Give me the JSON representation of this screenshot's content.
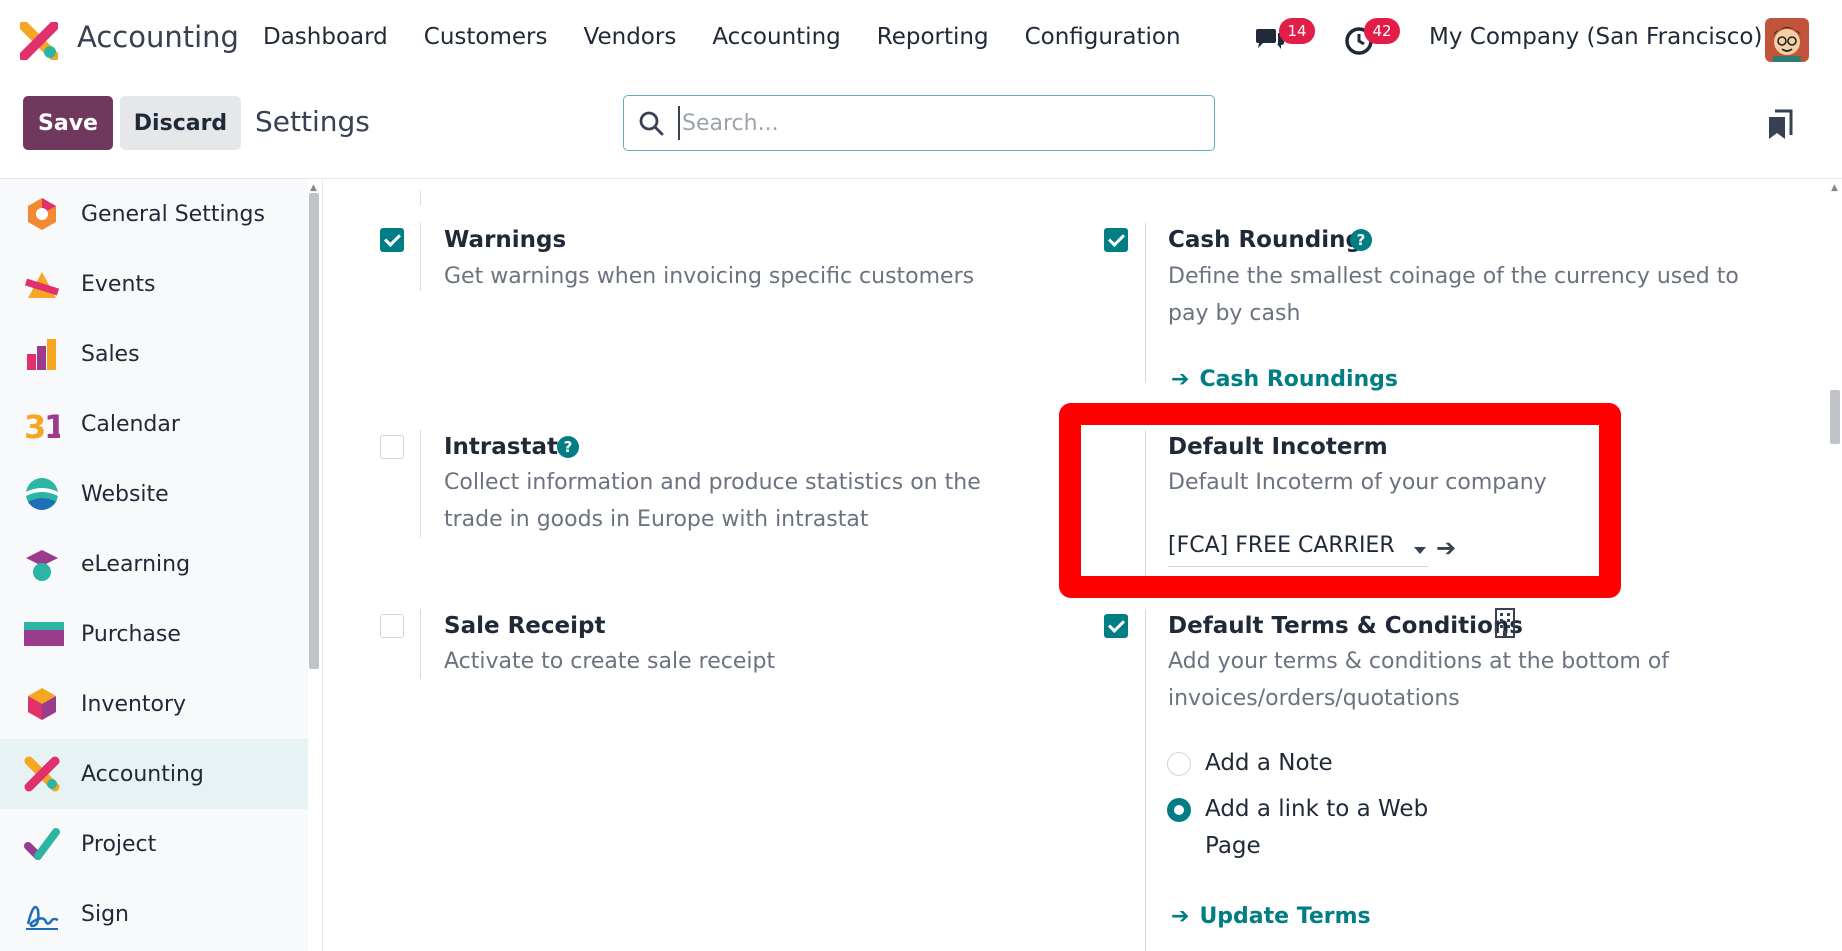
{
  "navbar": {
    "app_name": "Accounting",
    "menu": [
      "Dashboard",
      "Customers",
      "Vendors",
      "Accounting",
      "Reporting",
      "Configuration"
    ],
    "chat_count": "14",
    "activity_count": "42",
    "company": "My Company (San Francisco)"
  },
  "control": {
    "save_label": "Save",
    "discard_label": "Discard",
    "title": "Settings",
    "search_placeholder": "Search..."
  },
  "sidebar": {
    "items": [
      {
        "label": "General Settings",
        "icon": "general-settings-icon"
      },
      {
        "label": "Events",
        "icon": "events-icon"
      },
      {
        "label": "Sales",
        "icon": "sales-icon"
      },
      {
        "label": "Calendar",
        "icon": "calendar-icon"
      },
      {
        "label": "Website",
        "icon": "website-icon"
      },
      {
        "label": "eLearning",
        "icon": "elearning-icon"
      },
      {
        "label": "Purchase",
        "icon": "purchase-icon"
      },
      {
        "label": "Inventory",
        "icon": "inventory-icon"
      },
      {
        "label": "Accounting",
        "icon": "accounting-icon",
        "active": true
      },
      {
        "label": "Project",
        "icon": "project-icon"
      },
      {
        "label": "Sign",
        "icon": "sign-icon"
      }
    ]
  },
  "settings": {
    "warnings": {
      "title": "Warnings",
      "desc": "Get warnings when invoicing specific customers",
      "checked": true
    },
    "cash_rounding": {
      "title": "Cash Rounding",
      "desc_1": "Define the smallest coinage of the currency used to",
      "desc_2": "pay by cash",
      "link": "Cash Roundings",
      "checked": true
    },
    "intrastat": {
      "title": "Intrastat",
      "desc_1": "Collect information and produce statistics on the",
      "desc_2": "trade in goods in Europe with intrastat",
      "checked": false
    },
    "incoterm": {
      "title": "Default Incoterm",
      "desc": "Default Incoterm of your company",
      "value": "[FCA] FREE CARRIER"
    },
    "sale_receipt": {
      "title": "Sale Receipt",
      "desc": "Activate to create sale receipt",
      "checked": false
    },
    "terms": {
      "title": "Default Terms & Conditions",
      "desc_1": "Add your terms & conditions at the bottom of",
      "desc_2": "invoices/orders/quotations",
      "checked": true,
      "option_note": "Add a Note",
      "option_link_1": "Add a link to a Web",
      "option_link_2": "Page",
      "selected": "link",
      "link": "Update Terms"
    }
  },
  "colors": {
    "primary": "#71385f",
    "accent": "#017e84",
    "highlight": "#ff0000",
    "badge": "#e11d48"
  }
}
